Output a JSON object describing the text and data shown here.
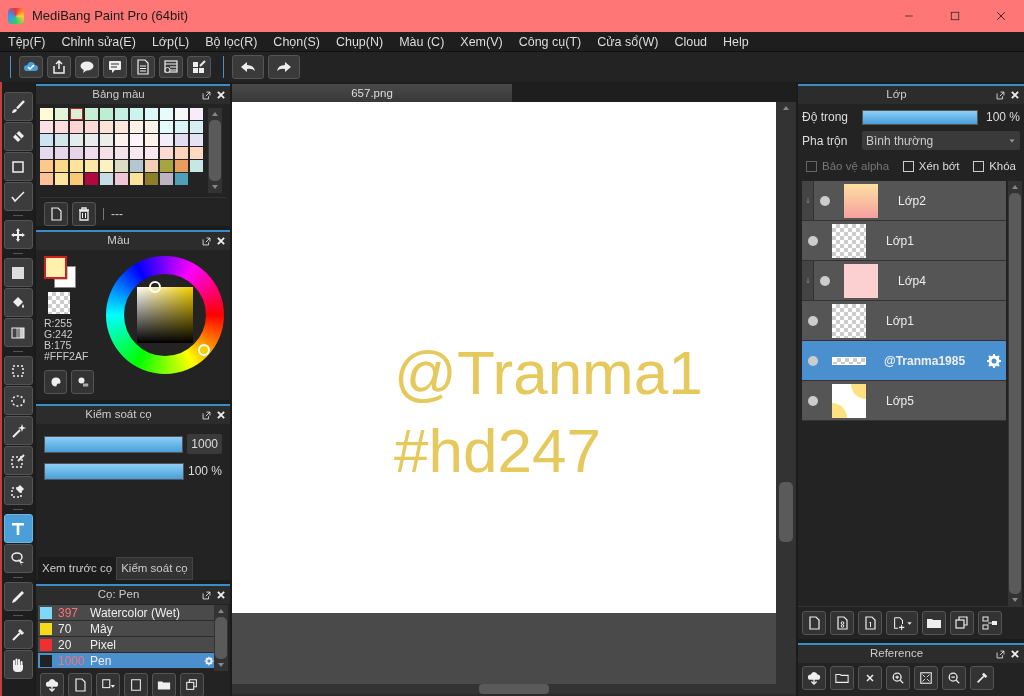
{
  "window": {
    "title": "MediBang Paint Pro (64bit)"
  },
  "menu": [
    "Tệp(F)",
    "Chỉnh sửa(E)",
    "Lớp(L)",
    "Bộ lọc(R)",
    "Chọn(S)",
    "Chụp(N)",
    "Màu (C)",
    "Xem(V)",
    "Công cụ(T)",
    "Cửa sổ(W)",
    "Cloud",
    "Help"
  ],
  "tools": [
    {
      "selected": false
    },
    {
      "selected": false
    },
    {
      "selected": false
    },
    {
      "selected": false
    },
    {
      "selected": false
    },
    {
      "selected": false
    },
    {
      "selected": false
    },
    {
      "selected": false
    },
    {
      "selected": false
    },
    {
      "selected": false
    },
    {
      "selected": false
    },
    {
      "selected": false
    },
    {
      "selected": false
    },
    {
      "selected": true
    },
    {
      "selected": false
    },
    {
      "selected": false
    },
    {
      "selected": false
    },
    {
      "selected": false
    }
  ],
  "palette": {
    "title": "Bảng màu",
    "swatches": [
      {
        "color": "#fffbd6",
        "selected": false
      },
      {
        "color": "#e3f5d6",
        "selected": false
      },
      {
        "color": "#d8f0d4",
        "selected": true
      },
      {
        "color": "#c8efd6",
        "selected": false
      },
      {
        "color": "#bdeed4",
        "selected": false
      },
      {
        "color": "#c3eee0",
        "selected": false
      },
      {
        "color": "#cdf3ef",
        "selected": false
      },
      {
        "color": "#dbf8fb",
        "selected": false
      },
      {
        "color": "#e7fbfd",
        "selected": false
      },
      {
        "color": "#f8f8fb",
        "selected": false
      },
      {
        "color": "#f8ecfb",
        "selected": false
      },
      {
        "color": "#fde0e4",
        "selected": false
      },
      {
        "color": "#fddcdc",
        "selected": false
      },
      {
        "color": "#fbd4d4",
        "selected": false
      },
      {
        "color": "#fcd9d2",
        "selected": false
      },
      {
        "color": "#fde3d6",
        "selected": false
      },
      {
        "color": "#fee8dc",
        "selected": false
      },
      {
        "color": "#fdf2e3",
        "selected": false
      },
      {
        "color": "#fcf3e8",
        "selected": false
      },
      {
        "color": "#e3fbfb",
        "selected": false
      },
      {
        "color": "#d9f5f8",
        "selected": false
      },
      {
        "color": "#d6eef0",
        "selected": false
      },
      {
        "color": "#cde3f3",
        "selected": false
      },
      {
        "color": "#d3e6ec",
        "selected": false
      },
      {
        "color": "#e3edee",
        "selected": false
      },
      {
        "color": "#e8ecec",
        "selected": false
      },
      {
        "color": "#ecefe8",
        "selected": false
      },
      {
        "color": "#fef2ee",
        "selected": false
      },
      {
        "color": "#fcf4f9",
        "selected": false
      },
      {
        "color": "#fef4ec",
        "selected": false
      },
      {
        "color": "#f3eefb",
        "selected": false
      },
      {
        "color": "#e1dcf1",
        "selected": false
      },
      {
        "color": "#e4e2f4",
        "selected": false
      },
      {
        "color": "#e4d9ef",
        "selected": false
      },
      {
        "color": "#e6d6ec",
        "selected": false
      },
      {
        "color": "#e8d4ea",
        "selected": false
      },
      {
        "color": "#f0dcec",
        "selected": false
      },
      {
        "color": "#f7dfe8",
        "selected": false
      },
      {
        "color": "#f4e2ea",
        "selected": false
      },
      {
        "color": "#f6e8ee",
        "selected": false
      },
      {
        "color": "#fbe7ee",
        "selected": false
      },
      {
        "color": "#fbdad2",
        "selected": false
      },
      {
        "color": "#fcd4bd",
        "selected": false
      },
      {
        "color": "#fed9c2",
        "selected": false
      },
      {
        "color": "#fdc98a",
        "selected": false
      },
      {
        "color": "#fbd88a",
        "selected": false
      },
      {
        "color": "#fde49a",
        "selected": false
      },
      {
        "color": "#fbe7a6",
        "selected": false
      },
      {
        "color": "#fcf1c0",
        "selected": false
      },
      {
        "color": "#dcdcc4",
        "selected": false
      },
      {
        "color": "#b3c7cf",
        "selected": false
      },
      {
        "color": "#f3cfb7",
        "selected": false
      },
      {
        "color": "#a8a440",
        "selected": false
      },
      {
        "color": "#e79d5b",
        "selected": false
      },
      {
        "color": "#c7e7e4",
        "selected": false
      },
      {
        "color": "#fdc199",
        "selected": false
      },
      {
        "color": "#fde5a0",
        "selected": false
      },
      {
        "color": "#fbc875",
        "selected": false
      },
      {
        "color": "#b3083f",
        "selected": false
      },
      {
        "color": "#c7dde5",
        "selected": false
      },
      {
        "color": "#eec6d4",
        "selected": false
      },
      {
        "color": "#fde398",
        "selected": false
      },
      {
        "color": "#8b7f2b",
        "selected": false
      },
      {
        "color": "#bcb3c2",
        "selected": false
      },
      {
        "color": "#4f9fb7",
        "selected": false
      }
    ],
    "color_name": "---"
  },
  "color_panel": {
    "title": "Màu",
    "values": [
      "R:255",
      "G:242",
      "B:175",
      "#FFF2AF"
    ]
  },
  "brush_control": {
    "title": "Kiểm soát cọ",
    "sliders": [
      {
        "kind": "boxed",
        "level": 1,
        "reading": "1000"
      },
      {
        "kind": "plain",
        "level": 1,
        "reading": "100 %"
      }
    ],
    "tabs": [
      {
        "label": "Xem trước cọ",
        "selected": false
      },
      {
        "label": "Kiểm soát cọ",
        "selected": true
      }
    ]
  },
  "brushes": {
    "title": "Cọ: Pen",
    "items": [
      {
        "color": "#80d8f8",
        "count": "397",
        "name": "Watercolor (Wet)",
        "highlighted": true,
        "selected": false
      },
      {
        "color": "#f2dc1c",
        "count": "70",
        "name": "Mây",
        "highlighted": false,
        "selected": false
      },
      {
        "color": "#f03030",
        "count": "20",
        "name": "Pixel",
        "highlighted": false,
        "selected": false
      },
      {
        "color": "#222222",
        "count": "1000",
        "name": "Pen",
        "highlighted": true,
        "selected": true
      }
    ]
  },
  "canvas": {
    "tab": "657.png",
    "text_lines": [
      "@Tranma1",
      "#hd247"
    ]
  },
  "layers": {
    "title": "Lớp",
    "opacity_label": "Độ trong",
    "opacity": {
      "level": 1
    },
    "opacity_reading": "100 %",
    "blend_label": "Pha trộn",
    "blend_value": "Bình thường",
    "options": [
      {
        "label": "Bảo vệ alpha",
        "checked": false,
        "disabled": true
      },
      {
        "label": "Xén bớt",
        "checked": false,
        "disabled": false
      },
      {
        "label": "Khóa",
        "checked": false,
        "disabled": false
      }
    ],
    "items": [
      {
        "kind": "image",
        "name": "Lớp2",
        "visible": true,
        "clipped": true,
        "selected": false
      },
      {
        "kind": "image",
        "name": "Lớp1",
        "visible": true,
        "clipped": false,
        "selected": false
      },
      {
        "kind": "image",
        "name": "Lớp4",
        "visible": true,
        "clipped": true,
        "selected": false
      },
      {
        "kind": "image",
        "name": "Lớp1",
        "visible": true,
        "clipped": false,
        "selected": false
      },
      {
        "kind": "text",
        "name": "@Tranma1985",
        "visible": true,
        "clipped": false,
        "selected": true
      },
      {
        "kind": "image",
        "name": "Lớp5",
        "visible": true,
        "clipped": false,
        "selected": false
      }
    ]
  },
  "reference": {
    "title": "Reference"
  }
}
